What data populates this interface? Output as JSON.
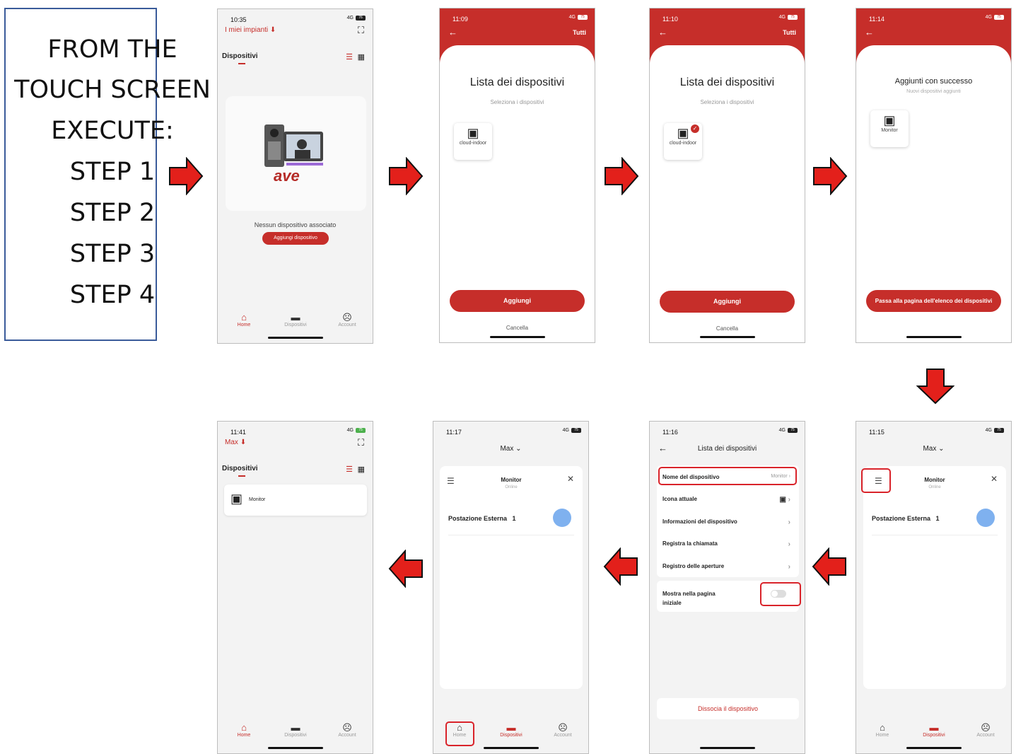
{
  "instructions": [
    "FROM THE",
    "TOUCH SCREEN",
    "EXECUTE:",
    "STEP 1",
    "STEP 2",
    "STEP 3",
    "STEP 4"
  ],
  "screen1": {
    "time": "10:35",
    "signal": "4G",
    "battery": "76",
    "plants": "I miei impianti",
    "section": "Dispositivi",
    "brand": "ave",
    "empty": "Nessun dispositivo associato",
    "add_btn": "Aggiungi dispositivo",
    "tabs": [
      "Home",
      "Dispositivi",
      "Account"
    ]
  },
  "screen2": {
    "time": "11:09",
    "signal": "4G",
    "battery": "75",
    "top_right": "Tutti",
    "title": "Lista dei dispositivi",
    "subtitle": "Seleziona i dispositivi",
    "device": "cloud-indoor",
    "add": "Aggiungi",
    "cancel": "Cancella"
  },
  "screen3": {
    "time": "11:10",
    "signal": "4G",
    "battery": "75",
    "top_right": "Tutti",
    "title": "Lista dei dispositivi",
    "subtitle": "Seleziona i dispositivi",
    "device": "cloud-indoor",
    "add": "Aggiungi",
    "cancel": "Cancella"
  },
  "screen4": {
    "time": "11:14",
    "signal": "4G",
    "battery": "75",
    "title": "Aggiunti con successo",
    "subtitle": "Nuovi dispositivi aggiunti",
    "device": "Monitor",
    "goto": "Passa alla pagina dell'elenco dei dispositivi"
  },
  "screen5": {
    "time": "11:15",
    "signal": "4G",
    "battery": "75",
    "plant": "Max",
    "device": "Monitor",
    "status": "Online",
    "station": "Postazione Esterna",
    "station_num": "1",
    "tabs": [
      "Home",
      "Dispositivi",
      "Account"
    ]
  },
  "screen6": {
    "time": "11:16",
    "signal": "4G",
    "battery": "75",
    "title": "Lista dei dispositivi",
    "rows": [
      {
        "label": "Nome del dispositivo",
        "value": "Monitor"
      },
      {
        "label": "Icona attuale",
        "value": ""
      },
      {
        "label": "Informazioni del dispositivo",
        "value": ""
      },
      {
        "label": "Registra la chiamata",
        "value": ""
      },
      {
        "label": "Registro delle aperture",
        "value": ""
      }
    ],
    "show_home_1": "Mostra nella pagina",
    "show_home_2": "iniziale",
    "dissocia": "Dissocia il dispositivo"
  },
  "screen7": {
    "time": "11:17",
    "signal": "4G",
    "battery": "75",
    "plant": "Max",
    "device": "Monitor",
    "status": "Online",
    "station": "Postazione Esterna",
    "station_num": "1",
    "tabs": [
      "Home",
      "Dispositivi",
      "Account"
    ]
  },
  "screen8": {
    "time": "11:41",
    "signal": "4G",
    "battery": "75",
    "plant": "Max",
    "section": "Dispositivi",
    "device": "Monitor",
    "tabs": [
      "Home",
      "Dispositivi",
      "Account"
    ]
  },
  "colors": {
    "accent": "#c62e2a",
    "highlight": "#d9232a",
    "arrow": "#e3201b"
  }
}
